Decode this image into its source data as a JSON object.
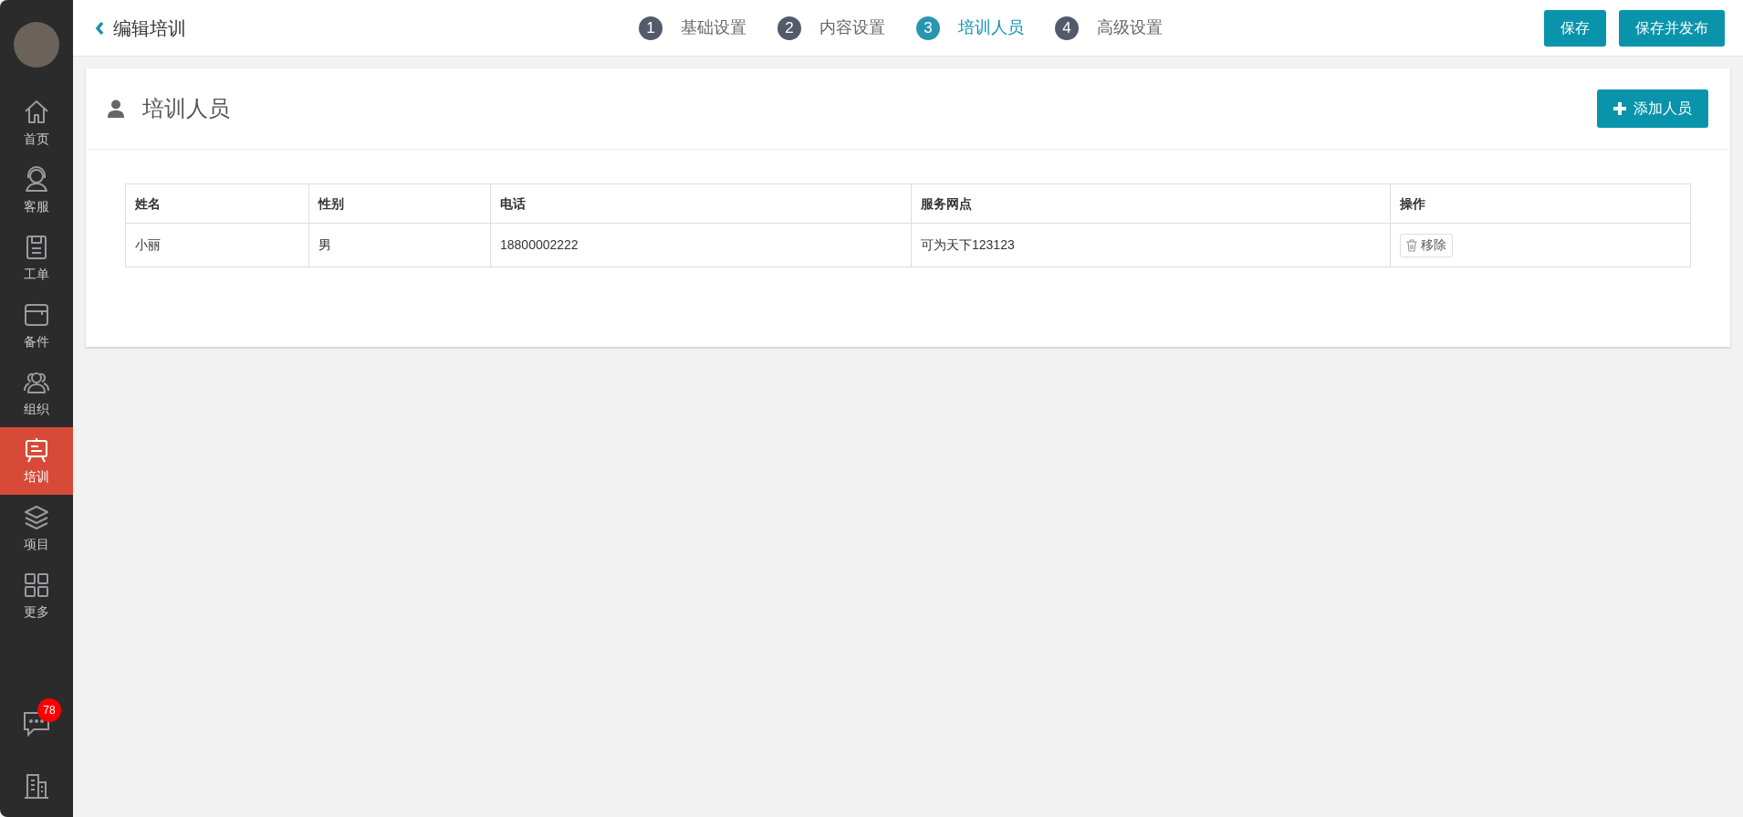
{
  "sidebar": {
    "items": [
      {
        "kind": "home",
        "label": "首页",
        "selected": false
      },
      {
        "kind": "service",
        "label": "客服",
        "selected": false
      },
      {
        "kind": "order",
        "label": "工单",
        "selected": false
      },
      {
        "kind": "parts",
        "label": "备件",
        "selected": false
      },
      {
        "kind": "org",
        "label": "组织",
        "selected": false
      },
      {
        "kind": "training",
        "label": "培训",
        "selected": true
      },
      {
        "kind": "project",
        "label": "项目",
        "selected": false
      },
      {
        "kind": "more",
        "label": "更多",
        "selected": false
      }
    ],
    "messages_badge": "78"
  },
  "header": {
    "back_title": "编辑培训",
    "steps": [
      {
        "number": "1",
        "label": "基础设置",
        "selected": false
      },
      {
        "number": "2",
        "label": "内容设置",
        "selected": false
      },
      {
        "number": "3",
        "label": "培训人员",
        "selected": true
      },
      {
        "number": "4",
        "label": "高级设置",
        "selected": false
      }
    ],
    "buttons": [
      "保存",
      "保存并发布"
    ]
  },
  "panel": {
    "title": "培训人员",
    "add_button": "添加人员",
    "table": {
      "columns": [
        "姓名",
        "性别",
        "电话",
        "服务网点",
        "操作"
      ],
      "rows": [
        {
          "cells": [
            "小丽",
            "男",
            "18800002222",
            "可为天下123123"
          ],
          "action": "移除"
        }
      ]
    }
  }
}
